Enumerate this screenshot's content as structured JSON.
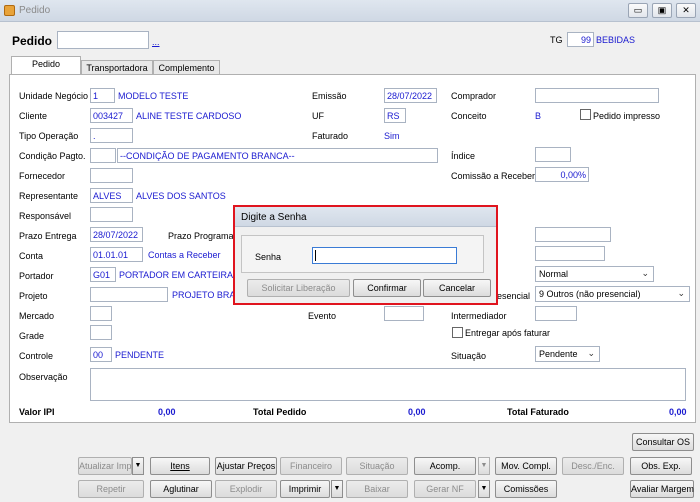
{
  "window": {
    "title": "Pedido",
    "buttons": [
      "▭",
      "▣",
      "✕"
    ]
  },
  "header": {
    "pedido_label": "Pedido",
    "pedido_value": "",
    "lookup_label": "...",
    "tg_label": "TG",
    "tg_code": "99",
    "tg_name": "BEBIDAS"
  },
  "tabs": [
    {
      "label": "Pedido",
      "active": true
    },
    {
      "label": "Transportadora",
      "active": false
    },
    {
      "label": "Complemento",
      "active": false
    }
  ],
  "form": {
    "unidade_negocio": {
      "label": "Unidade Negócio",
      "code": "1",
      "name": "MODELO TESTE"
    },
    "cliente": {
      "label": "Cliente",
      "code": "003427",
      "name": "ALINE TESTE CARDOSO"
    },
    "tipo_operacao": {
      "label": "Tipo Operação",
      "value": "."
    },
    "condicao_pagto": {
      "label": "Condição Pagto.",
      "code": "",
      "name": "--CONDIÇÃO DE PAGAMENTO BRANCA--"
    },
    "fornecedor": {
      "label": "Fornecedor",
      "value": ""
    },
    "representante": {
      "label": "Representante",
      "code": "ALVES",
      "name": "ALVES DOS SANTOS"
    },
    "responsavel": {
      "label": "Responsável",
      "value": ""
    },
    "prazo_entrega": {
      "label": "Prazo Entrega",
      "value": "28/07/2022"
    },
    "prazo_programado": {
      "label": "Prazo Programa"
    },
    "conta": {
      "label": "Conta",
      "code": "01.01.01",
      "name": "Contas a Receber"
    },
    "portador": {
      "label": "Portador",
      "code": "G01",
      "name": "PORTADOR EM CARTEIRA"
    },
    "projeto": {
      "label": "Projeto",
      "name": "PROJETO BRAN"
    },
    "mercado": {
      "label": "Mercado"
    },
    "grade": {
      "label": "Grade"
    },
    "controle": {
      "label": "Controle",
      "code": "00",
      "name": "PENDENTE"
    },
    "observacao": {
      "label": "Observação",
      "value": ""
    },
    "emissao": {
      "label": "Emissão",
      "value": "28/07/2022"
    },
    "uf": {
      "label": "UF",
      "value": "RS"
    },
    "faturado": {
      "label": "Faturado",
      "value": "Sim"
    },
    "evento": {
      "label": "Evento"
    },
    "comprador": {
      "label": "Comprador",
      "value": ""
    },
    "conceito": {
      "label": "Conceito",
      "value": "B"
    },
    "pedido_impresso": {
      "label": "Pedido impresso",
      "checked": false
    },
    "indice": {
      "label": "Índice",
      "value": ""
    },
    "comissao": {
      "label": "Comissão a Receber",
      "value": "0,00%"
    },
    "tipo_select": {
      "value": "Normal"
    },
    "presencial": {
      "label": "resencial",
      "value": "9 Outros (não presencial)"
    },
    "intermediador": {
      "label": "Intermediador"
    },
    "entregar_apos_faturar": {
      "label": "Entregar após faturar",
      "checked": false
    },
    "situacao": {
      "label": "Situação",
      "value": "Pendente"
    }
  },
  "totals": {
    "valor_ipi_label": "Valor IPI",
    "valor_ipi": "0,00",
    "total_pedido_label": "Total Pedido",
    "total_pedido": "0,00",
    "total_faturado_label": "Total Faturado",
    "total_faturado": "0,00"
  },
  "buttons": {
    "consultar_os": "Consultar OS",
    "atualizar_imp": "Atualizar Imp",
    "itens": "Itens",
    "ajustar_precos": "Ajustar Preços",
    "financeiro": "Financeiro",
    "situacao": "Situação",
    "acomp": "Acomp.",
    "mov_compl": "Mov. Compl.",
    "desc_enc": "Desc./Enc.",
    "obs_exp": "Obs. Exp.",
    "repetir": "Repetir",
    "aglutinar": "Aglutinar",
    "explodir": "Explodir",
    "imprimir": "Imprimir",
    "baixar": "Baixar",
    "gerar_nf": "Gerar NF",
    "comissoes": "Comissões",
    "avaliar_margem": "Avaliar Margem"
  },
  "dialog": {
    "title": "Digite a Senha",
    "senha_label": "Senha",
    "senha_value": "",
    "solicitar": "Solicitar Liberação",
    "confirmar": "Confirmar",
    "cancelar": "Cancelar",
    "highlight_color": "#e0141e"
  }
}
